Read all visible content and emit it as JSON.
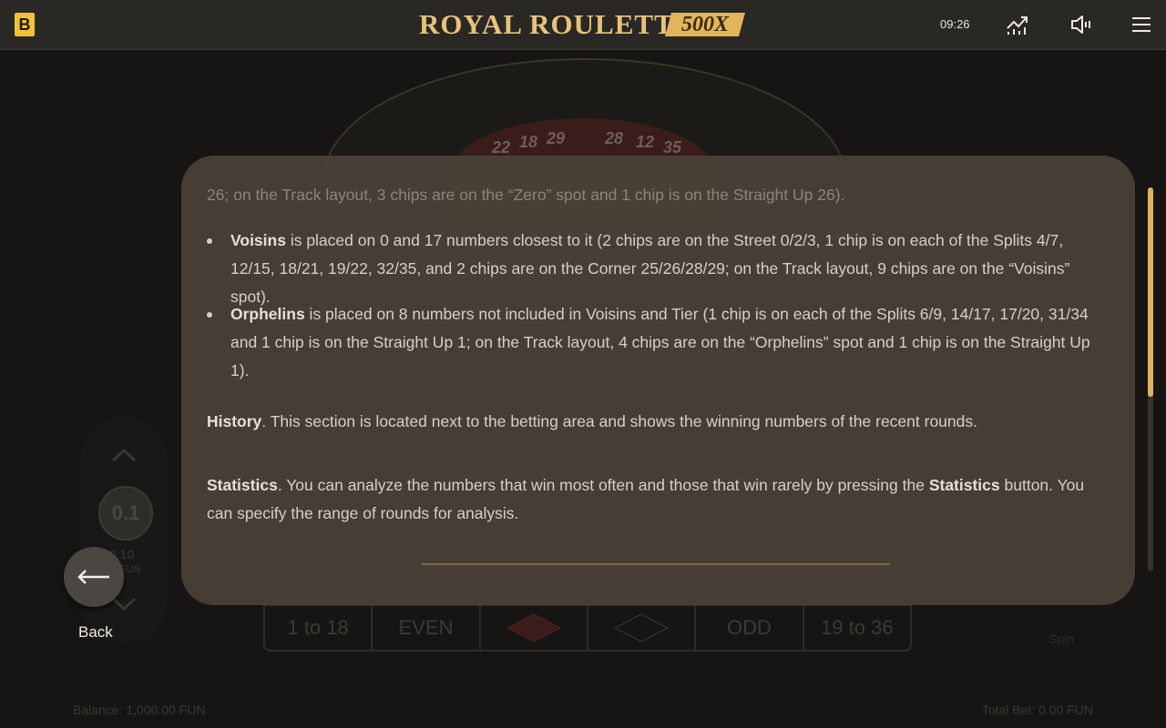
{
  "header": {
    "brand_letter": "B",
    "title": "ROYAL ROULETTE",
    "multiplier_badge": "500X",
    "time": "09:26",
    "icons": [
      "statistics-chart-icon",
      "sound-icon",
      "menu-icon"
    ]
  },
  "background": {
    "wheel_numbers": [
      "22",
      "18",
      "29",
      "28",
      "12",
      "35"
    ],
    "bet_row": [
      "1 to 18",
      "EVEN",
      "",
      "",
      "ODD",
      "19 to 36"
    ],
    "chip_value": "0.1",
    "chip_amount": "0.10",
    "chip_unit": "FUN",
    "spin_label": "Spin",
    "balance": "Balance: 1,000.00 FUN",
    "total_bet": "Total Bet: 0.00 FUN"
  },
  "rules": {
    "faded_line": "26; on the Track layout, 3 chips are on the “Zero” spot and 1 chip is on the Straight Up 26).",
    "voisins_term": "Voisins",
    "voisins_text": " is placed on 0 and 17 numbers closest to it (2 chips are on the Street 0/2/3, 1 chip is on each of the Splits 4/7, 12/15, 18/21, 19/22, 32/35, and 2 chips are on the Corner 25/26/28/29; on the Track layout, 9 chips are on the “Voisins” spot).",
    "orphelins_term": "Orphelins",
    "orphelins_text": " is placed on 8 numbers not included in Voisins and Tier (1 chip is on each of the Splits 6/9, 14/17, 17/20, 31/34 and 1 chip is on the Straight Up 1; on the Track layout, 4 chips are on the “Orphelins” spot and 1 chip is on the Straight Up 1).",
    "history_term": "History",
    "history_text": ". This section is located next to the betting area and shows the winning numbers of the recent rounds.",
    "statistics_term": "Statistics",
    "statistics_text_1": ". You can analyze the numbers that win most often and those that win rarely by pressing the ",
    "statistics_button_term": "Statistics",
    "statistics_text_2": " button. You can specify the range of rounds for analysis."
  },
  "back": {
    "label": "Back"
  },
  "colors": {
    "accent_gold": "#d9b466",
    "brand_yellow": "#f2c230",
    "modal_bg": "#4a4238"
  }
}
